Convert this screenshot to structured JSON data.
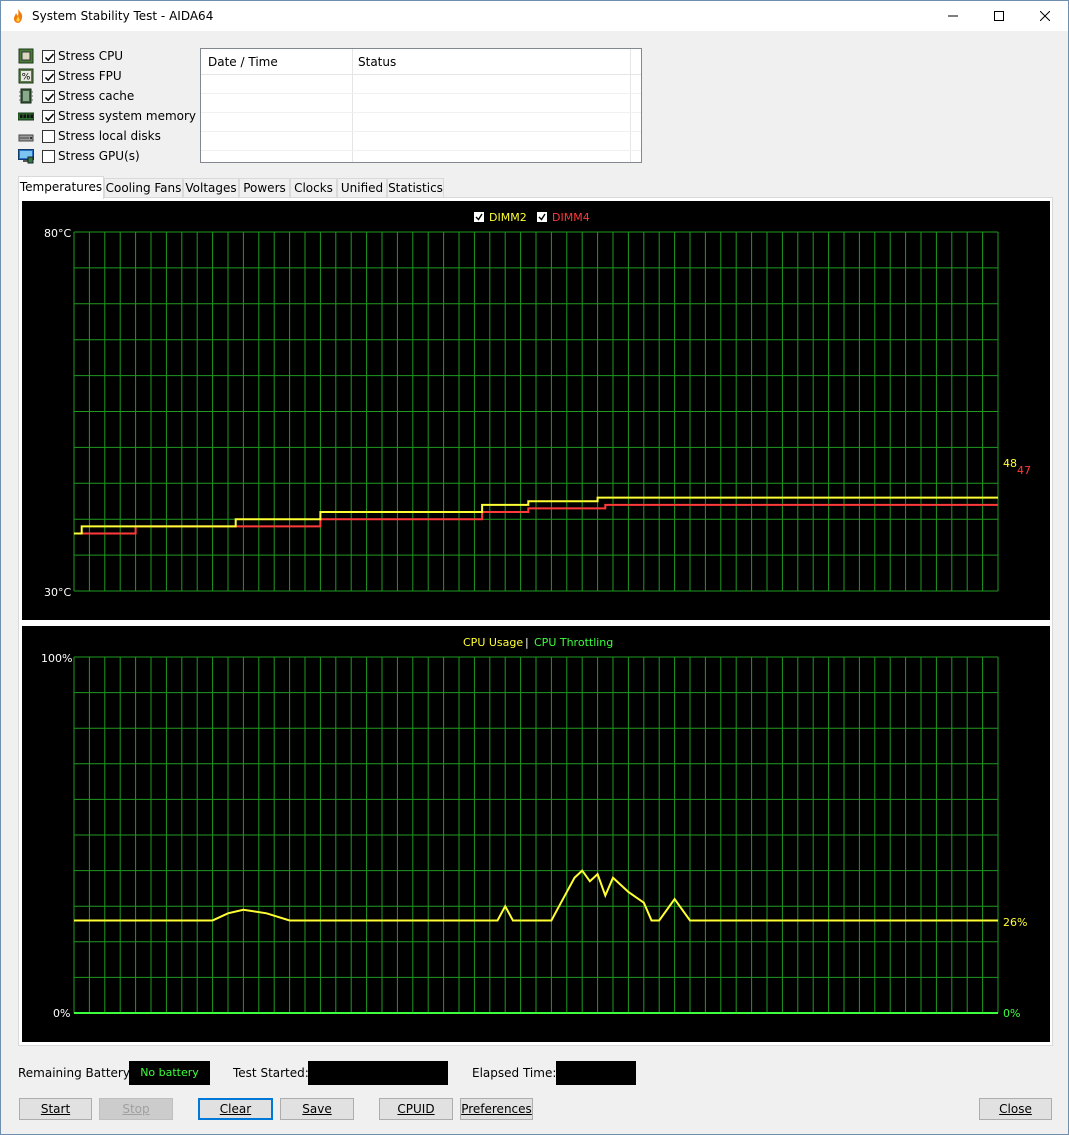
{
  "window": {
    "title": "System Stability Test - AIDA64"
  },
  "stress_options": [
    {
      "label": "Stress CPU",
      "checked": true,
      "icon": "cpu-chip-icon"
    },
    {
      "label": "Stress FPU",
      "checked": true,
      "icon": "fpu-percent-icon"
    },
    {
      "label": "Stress cache",
      "checked": true,
      "icon": "cache-chip-icon"
    },
    {
      "label": "Stress system memory",
      "checked": true,
      "icon": "memory-module-icon"
    },
    {
      "label": "Stress local disks",
      "checked": false,
      "icon": "disk-drive-icon"
    },
    {
      "label": "Stress GPU(s)",
      "checked": false,
      "icon": "monitor-gpu-icon"
    }
  ],
  "log_table": {
    "columns": [
      "Date / Time",
      "Status"
    ],
    "rows": []
  },
  "tabs": [
    {
      "label": "Temperatures",
      "active": true
    },
    {
      "label": "Cooling Fans",
      "active": false
    },
    {
      "label": "Voltages",
      "active": false
    },
    {
      "label": "Powers",
      "active": false
    },
    {
      "label": "Clocks",
      "active": false
    },
    {
      "label": "Unified",
      "active": false
    },
    {
      "label": "Statistics",
      "active": false
    }
  ],
  "temperature_graph": {
    "legend": [
      {
        "name": "DIMM2",
        "color": "#ffff33",
        "checked": true
      },
      {
        "name": "DIMM4",
        "color": "#ff3a3a",
        "checked": true
      }
    ],
    "y_max_label": "80°C",
    "y_min_label": "30°C",
    "ylim": [
      30,
      80
    ],
    "current_labels": [
      "48",
      "47"
    ]
  },
  "usage_graph": {
    "legend_usage": "CPU Usage",
    "legend_separator": "|",
    "legend_throttling": "CPU Throttling",
    "usage_color": "#ffff33",
    "throttling_color": "#3cff3c",
    "y_max_label": "100%",
    "y_min_label": "0%",
    "ylim": [
      0,
      100
    ],
    "current_usage_label": "26%",
    "current_throttling_label": "0%"
  },
  "chart_data": [
    {
      "type": "line",
      "ylim": [
        30,
        80
      ],
      "x": [
        0,
        1,
        7,
        8,
        20,
        21,
        26,
        27,
        31,
        32,
        36,
        37,
        48,
        49,
        52,
        53,
        58,
        59,
        68,
        69,
        120
      ],
      "series": [
        {
          "name": "DIMM2",
          "values": [
            38,
            39,
            39,
            39,
            39,
            40,
            40,
            40,
            40,
            41,
            41,
            41,
            41,
            41,
            41,
            42,
            42,
            42.5,
            43,
            43,
            43
          ]
        },
        {
          "name": "DIMM4",
          "values": [
            38,
            38,
            38,
            39,
            39,
            39,
            39,
            39,
            39,
            40,
            40,
            40,
            40,
            40,
            40,
            41,
            41,
            41.5,
            41.5,
            42,
            42
          ]
        }
      ]
    },
    {
      "type": "line",
      "ylim": [
        0,
        100
      ],
      "x": [
        0,
        5,
        10,
        15,
        18,
        20,
        22,
        25,
        28,
        30,
        35,
        40,
        45,
        50,
        55,
        56,
        57,
        60,
        62,
        63,
        64,
        65,
        66,
        67,
        68,
        69,
        70,
        72,
        74,
        75,
        76,
        78,
        80,
        82,
        84,
        86,
        88,
        90,
        95,
        100,
        105,
        110,
        115,
        120
      ],
      "series": [
        {
          "name": "CPU Usage",
          "values": [
            26,
            26,
            26,
            26,
            26,
            28,
            29,
            28,
            26,
            26,
            26,
            26,
            26,
            26,
            26,
            30,
            26,
            26,
            26,
            30,
            34,
            38,
            40,
            37,
            39,
            33,
            38,
            34,
            31,
            26,
            26,
            32,
            26,
            26,
            26,
            26,
            26,
            26,
            26,
            26,
            26,
            26,
            26,
            26
          ]
        },
        {
          "name": "CPU Throttling",
          "values": [
            0,
            0,
            0,
            0,
            0,
            0,
            0,
            0,
            0,
            0,
            0,
            0,
            0,
            0,
            0,
            0,
            0,
            0,
            0,
            0,
            0,
            0,
            0,
            0,
            0,
            0,
            0,
            0,
            0,
            0,
            0,
            0,
            0,
            0,
            0,
            0,
            0,
            0,
            0,
            0,
            0,
            0,
            0,
            0
          ]
        }
      ]
    }
  ],
  "status_bar": {
    "battery_label": "Remaining Battery:",
    "battery_value": "No battery",
    "test_started_label": "Test Started:",
    "test_started_value": "",
    "elapsed_label": "Elapsed Time:",
    "elapsed_value": ""
  },
  "buttons": {
    "start": "Start",
    "stop": "Stop",
    "clear": "Clear",
    "save": "Save",
    "cpuid": "CPUID",
    "preferences": "Preferences",
    "close": "Close"
  }
}
